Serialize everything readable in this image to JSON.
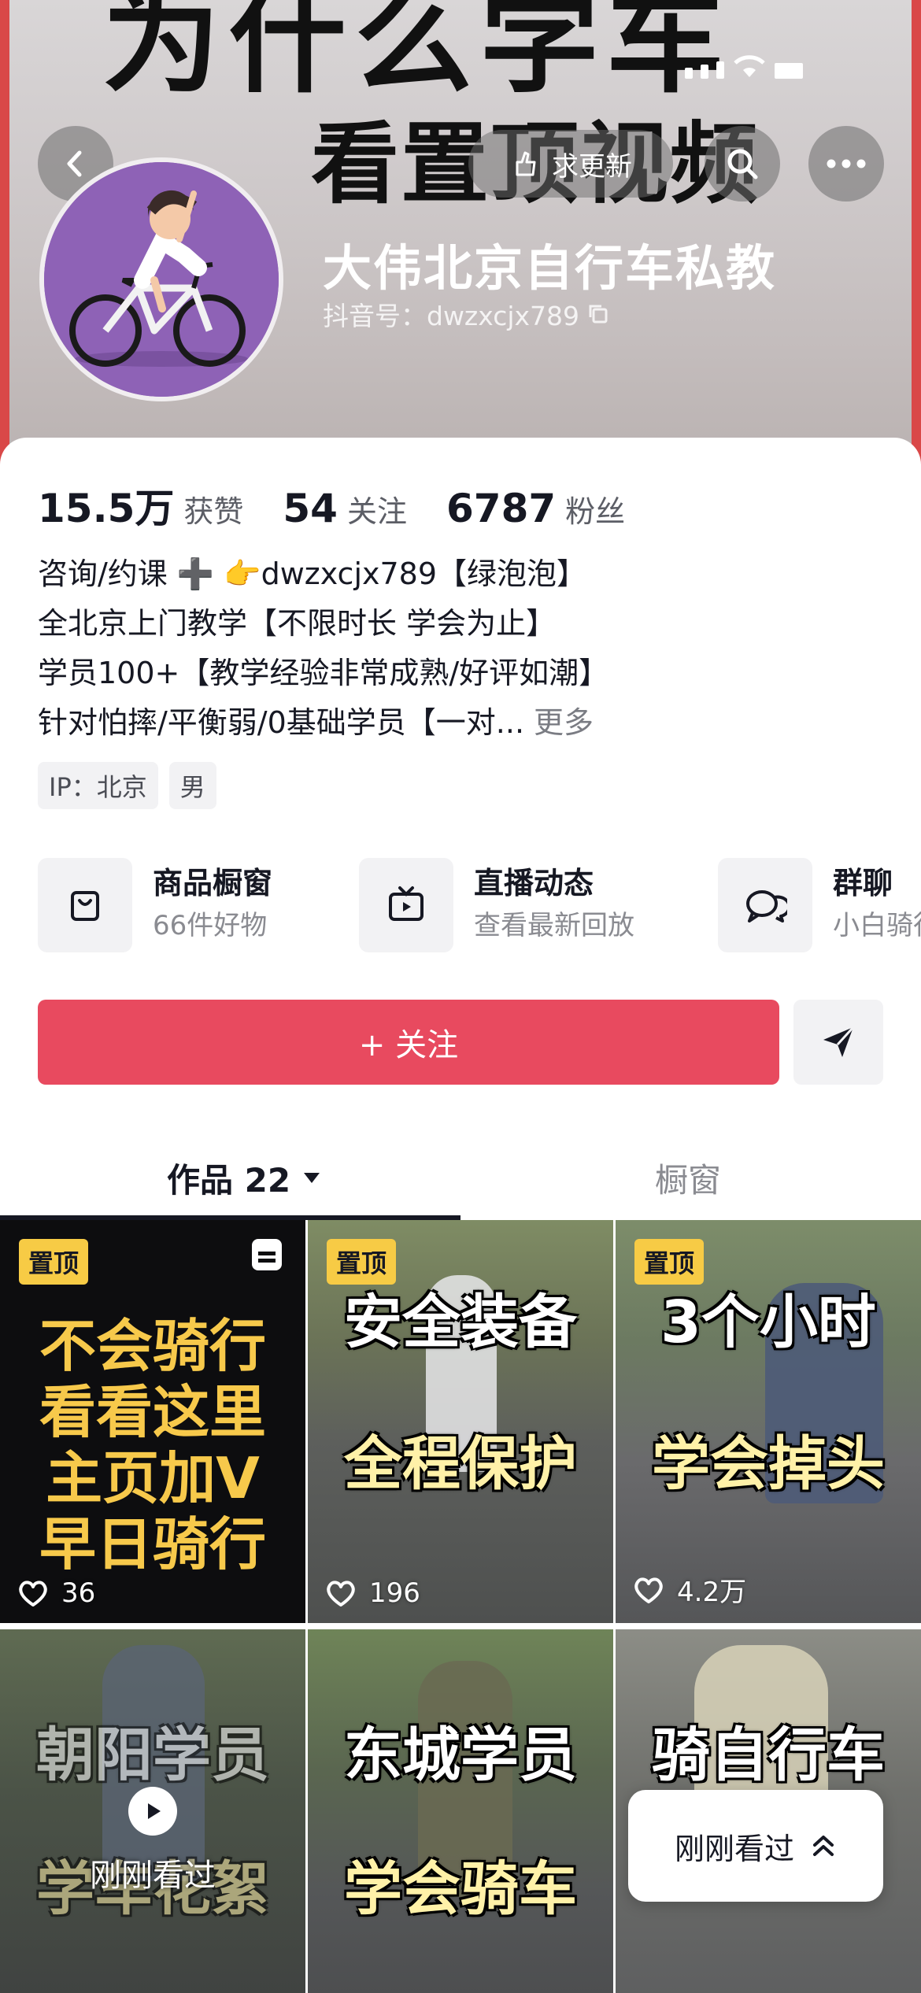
{
  "banner": {
    "line1": "为什么学车",
    "line2": "看置顶视频",
    "update_label": "求更新"
  },
  "profile": {
    "nickname": "大伟北京自行车私教",
    "douyin_id": "抖音号：dwzxcjx789"
  },
  "stats": [
    {
      "value": "15.5万",
      "label": "获赞"
    },
    {
      "value": "54",
      "label": "关注"
    },
    {
      "value": "6787",
      "label": "粉丝"
    }
  ],
  "bio": {
    "lines": [
      "咨询/约课 ➕ 👉dwzxcjx789【绿泡泡】",
      "全北京上门教学【不限时长 学会为止】",
      "学员100+【教学经验非常成熟/好评如潮】",
      "针对怕摔/平衡弱/0基础学员【一对..."
    ],
    "more": "更多"
  },
  "tags": [
    "IP：北京",
    "男"
  ],
  "features": [
    {
      "title": "商品橱窗",
      "subtitle": "66件好物",
      "icon": "shopping-bag-icon"
    },
    {
      "title": "直播动态",
      "subtitle": "查看最新回放",
      "icon": "tv-icon"
    },
    {
      "title": "群聊",
      "subtitle": "小白骑行",
      "icon": "chat-bubble-icon"
    }
  ],
  "actions": {
    "follow_label": "+ 关注"
  },
  "tabs": {
    "works": "作品 22",
    "shop": "橱窗"
  },
  "videos": [
    {
      "pinned": "置顶",
      "caption": [
        "不会骑行",
        "看看这里",
        "主页加V",
        "早日骑行"
      ],
      "likes": "36"
    },
    {
      "pinned": "置顶",
      "caption": [
        "安全装备",
        "全程保护"
      ],
      "likes": "196"
    },
    {
      "pinned": "置顶",
      "caption": [
        "3个小时",
        "学会掉头"
      ],
      "likes": "4.2万"
    },
    {
      "caption": [
        "朝阳学员",
        "学车花絮"
      ],
      "seen": "刚刚看过"
    },
    {
      "caption": [
        "东城学员",
        "学会骑车"
      ]
    },
    {
      "caption": [
        "骑自行车"
      ]
    }
  ],
  "recent_popup": {
    "label": "刚刚看过"
  },
  "colors": {
    "follow_red": "#e84a5f",
    "pin_yellow": "#f7cb45",
    "avatar_purple": "#8e62b6"
  }
}
